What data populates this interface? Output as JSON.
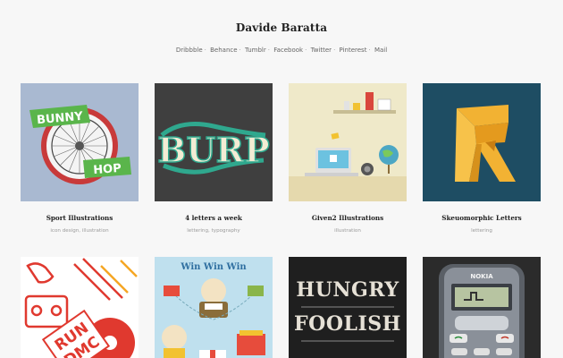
{
  "site": {
    "title": "Davide Baratta"
  },
  "social": [
    "Dribbble",
    "Behance",
    "Tumblr",
    "Facebook",
    "Twitter",
    "Pinterest",
    "Mail"
  ],
  "separator": "·",
  "projects": [
    {
      "title": "Sport Illustrations",
      "tags": "icon design, illustration",
      "art_text": [
        "BUNNY",
        "HOP"
      ]
    },
    {
      "title": "4 letters a week",
      "tags": "lettering, typography",
      "art_text": [
        "BURP"
      ]
    },
    {
      "title": "Given2 Illustrations",
      "tags": "illustration"
    },
    {
      "title": "Skeuomorphic Letters",
      "tags": "lettering"
    },
    {
      "title": "",
      "tags": "",
      "art_text": [
        "RUN",
        "DMC"
      ]
    },
    {
      "title": "",
      "tags": "",
      "art_text": [
        "Win Win Win"
      ]
    },
    {
      "title": "",
      "tags": "",
      "art_text": [
        "HUNGRY",
        "FOOLISH"
      ]
    },
    {
      "title": "",
      "tags": "",
      "art_text": [
        "NOKIA"
      ]
    }
  ],
  "colors": {
    "background": "#f7f7f7",
    "bunny_bg": "#a9b9d1",
    "bunny_banner": "#5ab54b",
    "burp_bg": "#3f3f3f",
    "burp_teal": "#2fa88e",
    "given_bg": "#efe9c9",
    "skeu_bg": "#1e4d63",
    "skeu_letter": "#f2b233",
    "hungry_bg": "#1f1f1f",
    "winwin_bg": "#bfe0ee"
  }
}
